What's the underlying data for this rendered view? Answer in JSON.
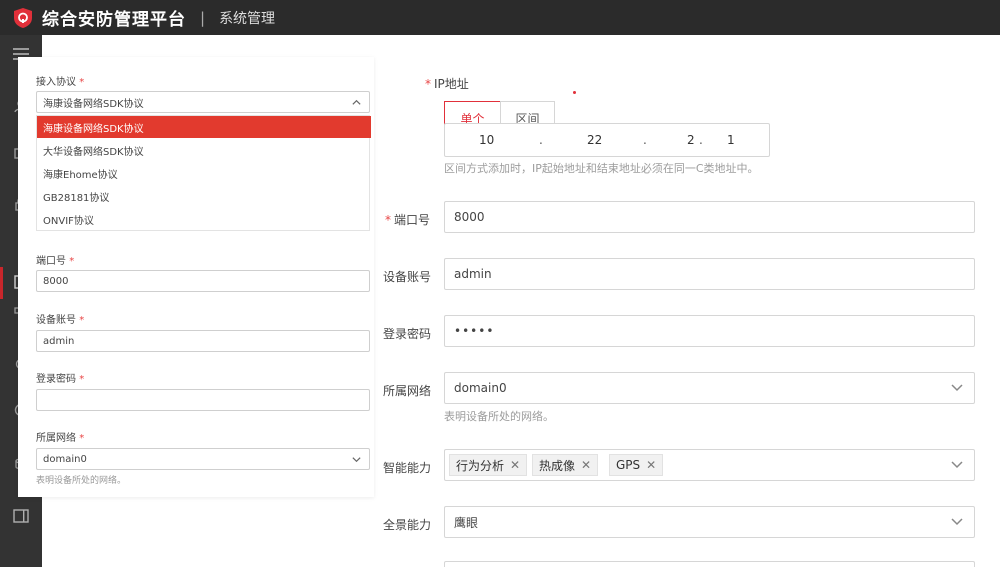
{
  "header": {
    "app_title": "综合安防管理平台",
    "separator": "|",
    "module_title": "系统管理"
  },
  "colors": {
    "accent": "#e1303a",
    "header_bg": "#2b2b2b",
    "rail_bg": "#333333"
  },
  "overlay_form": {
    "protocol_label": "接入协议",
    "protocol_value": "海康设备网络SDK协议",
    "protocol_options": [
      "海康设备网络SDK协议",
      "大华设备网络SDK协议",
      "海康Ehome协议",
      "GB28181协议",
      "ONVIF协议"
    ],
    "port_label": "端口号",
    "port_value": "8000",
    "account_label": "设备账号",
    "account_value": "admin",
    "password_label": "登录密码",
    "password_value": "",
    "network_label": "所属网络",
    "network_value": "domain0",
    "network_hint": "表明设备所处的网络。",
    "required_mark": "*"
  },
  "form": {
    "ip_label": "IP地址",
    "mode_single": "单个",
    "mode_range": "区间",
    "ip": [
      "10",
      "22",
      "2",
      "1"
    ],
    "ip_dot": ".",
    "ip_hint": "区间方式添加时，IP起始地址和结束地址必须在同一C类地址中。",
    "port_label": "端口号",
    "port_value": "8000",
    "account_label": "设备账号",
    "account_value": "admin",
    "password_label": "登录密码",
    "password_value": "•••••",
    "network_label": "所属网络",
    "network_value": "domain0",
    "network_hint": "表明设备所处的网络。",
    "smart_label": "智能能力",
    "smart_tags": [
      "行为分析",
      "热成像",
      "GPS"
    ],
    "tag_close": "✕",
    "panorama_label": "全景能力",
    "panorama_value": "鹰眼",
    "required_mark": "*"
  }
}
